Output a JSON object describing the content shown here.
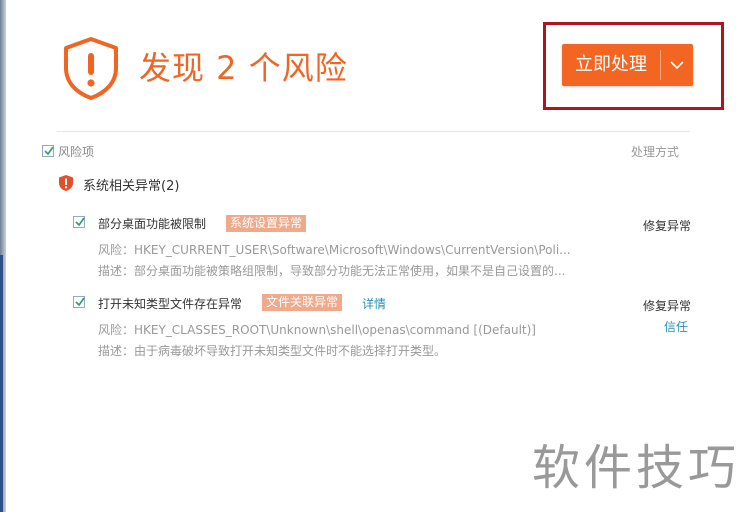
{
  "header": {
    "title": "发现 2 个风险",
    "primary_action": "立即处理",
    "accent_color": "#f26522"
  },
  "list_header": {
    "select_label": "风险项",
    "method_label": "处理方式"
  },
  "group": {
    "title": "系统相关异常(2)"
  },
  "items": [
    {
      "title": "部分桌面功能被限制",
      "tag": "系统设置异常",
      "risk": "风险：HKEY_CURRENT_USER\\Software\\Microsoft\\Windows\\CurrentVersion\\Poli...",
      "desc": "描述：部分桌面功能被策略组限制，导致部分功能无法正常使用，如果不是自己设置的...",
      "fix": "修复异常"
    },
    {
      "title": "打开未知类型文件存在异常",
      "tag": "文件关联异常",
      "detail": "详情",
      "risk": "风险：HKEY_CLASSES_ROOT\\Unknown\\shell\\openas\\command [(Default)]",
      "desc": "描述：由于病毒破坏导致打开未知类型文件时不能选择打开类型。",
      "fix": "修复异常",
      "trust": "信任"
    }
  ],
  "watermark": "软件技巧"
}
